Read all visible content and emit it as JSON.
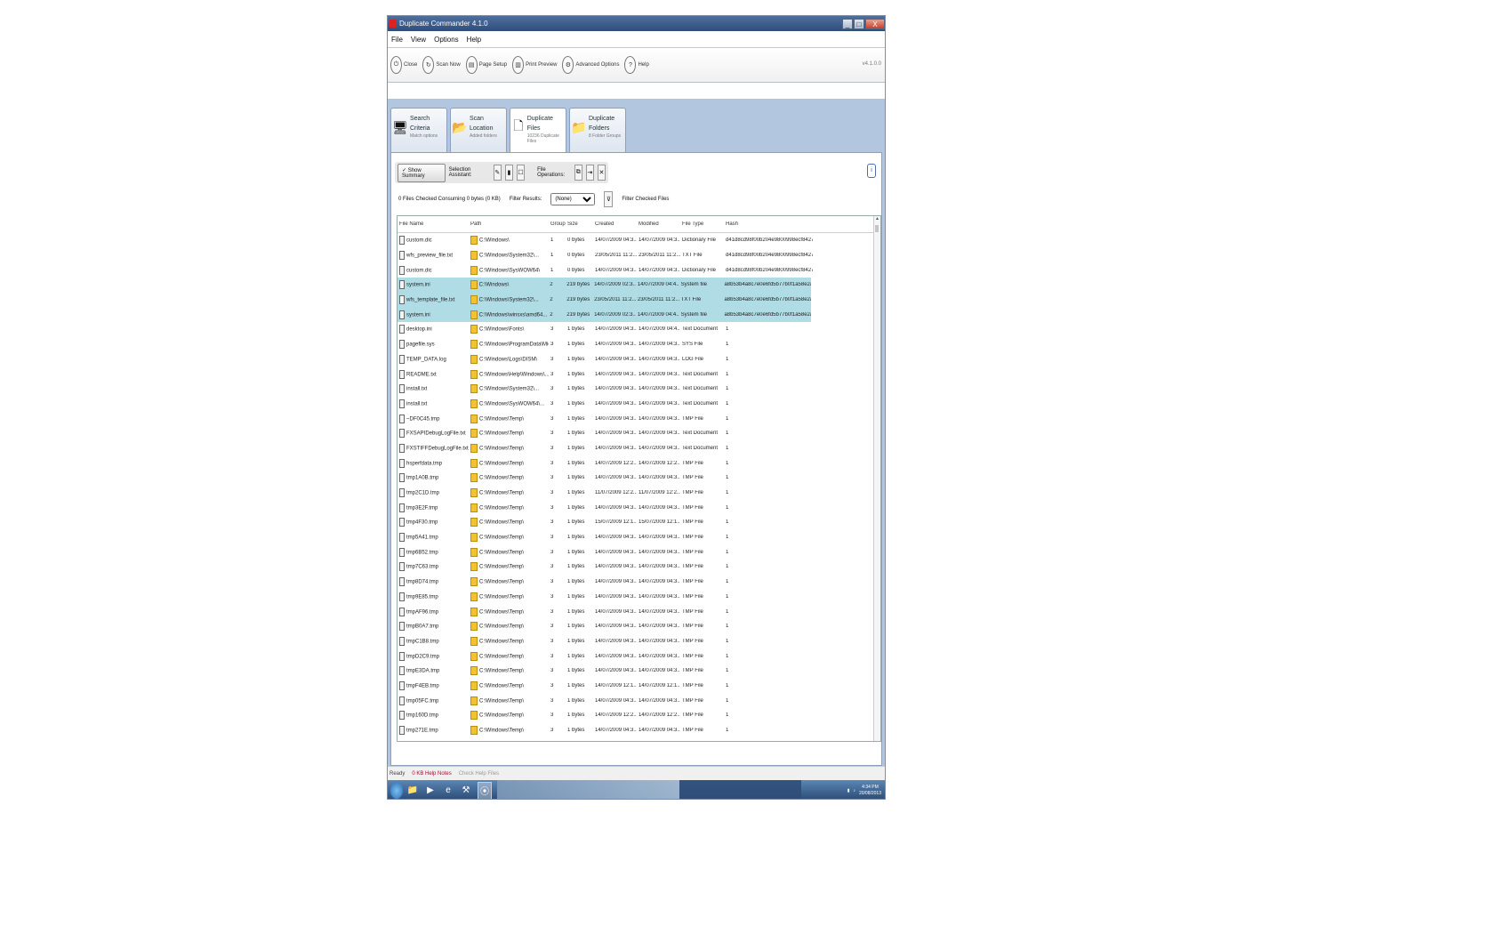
{
  "window": {
    "title": "Duplicate Commander 4.1.0",
    "controls": [
      "_",
      "□",
      "X"
    ]
  },
  "menu": [
    "File",
    "View",
    "Options",
    "Help"
  ],
  "toolbar": {
    "buttons": [
      {
        "icon": "power-icon",
        "label": "Close"
      },
      {
        "icon": "refresh-icon",
        "label": "Scan Now"
      },
      {
        "icon": "page-icon",
        "label": "Page Setup"
      },
      {
        "icon": "print-icon",
        "label": "Print Preview"
      },
      {
        "icon": "gear-icon",
        "label": "Advanced Options"
      },
      {
        "icon": "info-icon",
        "label": "Help"
      }
    ],
    "version": "v4.1.0.0"
  },
  "tabs": [
    {
      "title": "Search Criteria",
      "sub": "Match options",
      "icon": "monitor-icon"
    },
    {
      "title": "Scan Location",
      "sub": "Added folders",
      "icon": "folder-search-icon"
    },
    {
      "title": "Duplicate Files",
      "sub": "10236 Duplicate Files",
      "icon": "documents-icon"
    },
    {
      "title": "Duplicate Folders",
      "sub": "8 Folder Groups",
      "icon": "folders-icon"
    }
  ],
  "filter": {
    "summary_button": "Show Summary",
    "selection_label": "Selection Assistant:",
    "operations_label": "File Operations:"
  },
  "status_line": {
    "checked_text": "0 Files Checked Consuming 0 bytes (0 KB)",
    "filter_label": "Filter Results:",
    "filter_value": "(None)",
    "filter_checked": "Filter Checked Files"
  },
  "table": {
    "columns": [
      "File Name",
      "Path",
      "Group",
      "Size",
      "Created",
      "Modified",
      "File Type",
      "Hash"
    ],
    "rows": [
      [
        "custom.dic",
        "C:\\Windows\\",
        "1",
        "0 bytes",
        "14/07/2009 04:3...",
        "14/07/2009 04:3...",
        "Dictionary File",
        "d41d8cd98f00b204e9800998ecf8427e"
      ],
      [
        "wfs_preview_file.txt",
        "C:\\Windows\\System32\\...",
        "1",
        "0 bytes",
        "23/05/2011 11:2...",
        "23/05/2011 11:2...",
        "TXT File",
        "d41d8cd98f00b204e9800998ecf8427e"
      ],
      [
        "custom.dic",
        "C:\\Windows\\SysWOW64\\",
        "1",
        "0 bytes",
        "14/07/2009 04:3...",
        "14/07/2009 04:3...",
        "Dictionary File",
        "d41d8cd98f00b204e9800998ecf8427e"
      ],
      [
        "system.ini",
        "C:\\Windows\\",
        "2",
        "219 bytes",
        "14/07/2009 02:3...",
        "14/07/2009 04:4...",
        "System file",
        "a8b53b4a8c7e0e6fd5b77b0f1a58e2a3"
      ],
      [
        "wfs_template_file.txt",
        "C:\\Windows\\System32\\...",
        "2",
        "219 bytes",
        "23/05/2011 11:2...",
        "23/05/2011 11:2...",
        "TXT File",
        "a8b53b4a8c7e0e6fd5b77b0f1a58e2a3"
      ],
      [
        "system.ini",
        "C:\\Windows\\winsxs\\amd64...",
        "2",
        "219 bytes",
        "14/07/2009 02:3...",
        "14/07/2009 04:4...",
        "System file",
        "a8b53b4a8c7e0e6fd5b77b0f1a58e2a3"
      ],
      [
        "desktop.ini",
        "C:\\Windows\\Fonts\\",
        "3",
        "1 bytes",
        "14/07/2009 04:3...",
        "14/07/2009 04:4...",
        "Text Document",
        "1"
      ],
      [
        "pagefile.sys",
        "C:\\Windows\\ProgramData\\Micr...",
        "3",
        "1 bytes",
        "14/07/2009 04:3...",
        "14/07/2009 04:3...",
        "SYS File",
        "1"
      ],
      [
        "TEMP_DATA.log",
        "C:\\Windows\\Logs\\DISM\\",
        "3",
        "1 bytes",
        "14/07/2009 04:3...",
        "14/07/2009 04:3...",
        "LOG File",
        "1"
      ],
      [
        "README.txt",
        "C:\\Windows\\Help\\Windows\\...",
        "3",
        "1 bytes",
        "14/07/2009 04:3...",
        "14/07/2009 04:3...",
        "Text Document",
        "1"
      ],
      [
        "install.txt",
        "C:\\Windows\\System32\\...",
        "3",
        "1 bytes",
        "14/07/2009 04:3...",
        "14/07/2009 04:3...",
        "Text Document",
        "1"
      ],
      [
        "install.txt",
        "C:\\Windows\\SysWOW64\\...",
        "3",
        "1 bytes",
        "14/07/2009 04:3...",
        "14/07/2009 04:3...",
        "Text Document",
        "1"
      ],
      [
        "~DF0C45.tmp",
        "C:\\Windows\\Temp\\",
        "3",
        "1 bytes",
        "14/07/2009 04:3...",
        "14/07/2009 04:3...",
        "TMP File",
        "1"
      ],
      [
        "FXSAPIDebugLogFile.txt",
        "C:\\Windows\\Temp\\",
        "3",
        "1 bytes",
        "14/07/2009 04:3...",
        "14/07/2009 04:3...",
        "Text Document",
        "1"
      ],
      [
        "FXSTIFFDebugLogFile.txt",
        "C:\\Windows\\Temp\\",
        "3",
        "1 bytes",
        "14/07/2009 04:3...",
        "14/07/2009 04:3...",
        "Text Document",
        "1"
      ],
      [
        "hsperfdata.tmp",
        "C:\\Windows\\Temp\\",
        "3",
        "1 bytes",
        "14/07/2009 12:2...",
        "14/07/2009 12:2...",
        "TMP File",
        "1"
      ],
      [
        "tmp1A0B.tmp",
        "C:\\Windows\\Temp\\",
        "3",
        "1 bytes",
        "14/07/2009 04:3...",
        "14/07/2009 04:3...",
        "TMP File",
        "1"
      ],
      [
        "tmp2C1D.tmp",
        "C:\\Windows\\Temp\\",
        "3",
        "1 bytes",
        "11/07/2009 12:2...",
        "11/07/2009 12:2...",
        "TMP File",
        "1"
      ],
      [
        "tmp3E2F.tmp",
        "C:\\Windows\\Temp\\",
        "3",
        "1 bytes",
        "14/07/2009 04:3...",
        "14/07/2009 04:3...",
        "TMP File",
        "1"
      ],
      [
        "tmp4F30.tmp",
        "C:\\Windows\\Temp\\",
        "3",
        "1 bytes",
        "15/07/2009 12:1...",
        "15/07/2009 12:1...",
        "TMP File",
        "1"
      ],
      [
        "tmp5A41.tmp",
        "C:\\Windows\\Temp\\",
        "3",
        "1 bytes",
        "14/07/2009 04:3...",
        "14/07/2009 04:3...",
        "TMP File",
        "1"
      ],
      [
        "tmp6B52.tmp",
        "C:\\Windows\\Temp\\",
        "3",
        "1 bytes",
        "14/07/2009 04:3...",
        "14/07/2009 04:3...",
        "TMP File",
        "1"
      ],
      [
        "tmp7C63.tmp",
        "C:\\Windows\\Temp\\",
        "3",
        "1 bytes",
        "14/07/2009 04:3...",
        "14/07/2009 04:3...",
        "TMP File",
        "1"
      ],
      [
        "tmp8D74.tmp",
        "C:\\Windows\\Temp\\",
        "3",
        "1 bytes",
        "14/07/2009 04:3...",
        "14/07/2009 04:3...",
        "TMP File",
        "1"
      ],
      [
        "tmp9E85.tmp",
        "C:\\Windows\\Temp\\",
        "3",
        "1 bytes",
        "14/07/2009 04:3...",
        "14/07/2009 04:3...",
        "TMP File",
        "1"
      ],
      [
        "tmpAF96.tmp",
        "C:\\Windows\\Temp\\",
        "3",
        "1 bytes",
        "14/07/2009 04:3...",
        "14/07/2009 04:3...",
        "TMP File",
        "1"
      ],
      [
        "tmpB0A7.tmp",
        "C:\\Windows\\Temp\\",
        "3",
        "1 bytes",
        "14/07/2009 04:3...",
        "14/07/2009 04:3...",
        "TMP File",
        "1"
      ],
      [
        "tmpC1B8.tmp",
        "C:\\Windows\\Temp\\",
        "3",
        "1 bytes",
        "14/07/2009 04:3...",
        "14/07/2009 04:3...",
        "TMP File",
        "1"
      ],
      [
        "tmpD2C9.tmp",
        "C:\\Windows\\Temp\\",
        "3",
        "1 bytes",
        "14/07/2009 04:3...",
        "14/07/2009 04:3...",
        "TMP File",
        "1"
      ],
      [
        "tmpE3DA.tmp",
        "C:\\Windows\\Temp\\",
        "3",
        "1 bytes",
        "14/07/2009 04:3...",
        "14/07/2009 04:3...",
        "TMP File",
        "1"
      ],
      [
        "tmpF4EB.tmp",
        "C:\\Windows\\Temp\\",
        "3",
        "1 bytes",
        "14/07/2009 12:1...",
        "14/07/2009 12:1...",
        "TMP File",
        "1"
      ],
      [
        "tmp05FC.tmp",
        "C:\\Windows\\Temp\\",
        "3",
        "1 bytes",
        "14/07/2009 04:3...",
        "14/07/2009 04:3...",
        "TMP File",
        "1"
      ],
      [
        "tmp160D.tmp",
        "C:\\Windows\\Temp\\",
        "3",
        "1 bytes",
        "14/07/2009 12:2...",
        "14/07/2009 12:2...",
        "TMP File",
        "1"
      ],
      [
        "tmp271E.tmp",
        "C:\\Windows\\Temp\\",
        "3",
        "1 bytes",
        "14/07/2009 04:3...",
        "14/07/2009 04:3...",
        "TMP File",
        "1"
      ]
    ],
    "selected_rows": [
      3,
      4,
      5
    ]
  },
  "statusbar": {
    "ready": "Ready",
    "link": "0 KB Help Notes",
    "extra": "Check Help Files"
  },
  "taskbar": {
    "items": [
      "start-orb-icon",
      "explorer-icon",
      "media-icon",
      "ie-icon",
      "tool-icon",
      "app-icon"
    ],
    "clock_time": "4:34 PM",
    "clock_date": "20/08/2013"
  }
}
